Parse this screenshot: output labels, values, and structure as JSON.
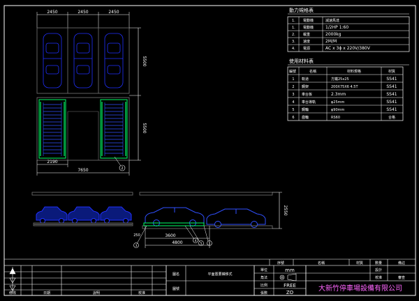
{
  "plan_dims": {
    "top": [
      "2450",
      "2450",
      "2450"
    ],
    "right_upper": "5500",
    "right_lower": "5500",
    "bottom_a": "2190",
    "bottom_b": "7650",
    "bay_label": "2"
  },
  "elevation_dims": {
    "left": "250",
    "middle": "3600",
    "total": "4800",
    "height": "2550",
    "callouts": [
      "3",
      "4",
      "5",
      "1"
    ]
  },
  "power_table": {
    "title": "動力規格表",
    "rows": [
      {
        "no": "1.",
        "item": "電動機",
        "spec": "減速馬達"
      },
      {
        "no": "1.",
        "item": "電動機",
        "spec": "1/2HP 1:60"
      },
      {
        "no": "2.",
        "item": "載重",
        "spec": "2000kg"
      },
      {
        "no": "3.",
        "item": "速度",
        "spec": "2M/M"
      },
      {
        "no": "4.",
        "item": "電源",
        "spec": "AC x 3ϕ x 220V/380V"
      }
    ]
  },
  "material_table": {
    "title": "使用材料表",
    "headers": [
      "編號",
      "名稱",
      "材料規格",
      "材質"
    ],
    "rows": [
      {
        "no": "1",
        "name": "軌道",
        "spec": "方鐵25x25",
        "mat": "SS41"
      },
      {
        "no": "2",
        "name": "鋼架",
        "spec": "200X75X6 4.5T",
        "mat": "SS41"
      },
      {
        "no": "3",
        "name": "車台板",
        "spec": "2.3mm",
        "mat": "SS41"
      },
      {
        "no": "4",
        "name": "車台導軌",
        "spec": "φ25mm",
        "mat": "SS41"
      },
      {
        "no": "5",
        "name": "鋼輪",
        "spec": "φ90mm",
        "mat": "SS41"
      },
      {
        "no": "6",
        "name": "齒輪",
        "spec": "RS60",
        "mat": "合格"
      }
    ]
  },
  "title_block": {
    "revision_label": "修改",
    "date_label": "日期",
    "description_label": "說明",
    "check_label": "校准",
    "drawing_name_label": "圖名",
    "drawing_name": "平面置要橫移式",
    "drawing_no_label": "圖號",
    "unit_label": "單位",
    "unit_value": "mm",
    "projection_label": "角法",
    "scale_label": "比例",
    "scale_value": "FREE",
    "sheet_label": "張數",
    "sheet_value": "ZO",
    "no_col": "序號",
    "name_col": "名稱",
    "material_col": "材質",
    "qty_col": "數量",
    "remark_col": "備註",
    "designer_label": "設計",
    "checker_label": "校准",
    "approver_label": "審查",
    "company": "大新竹停車場設備有限公司"
  },
  "colors": {
    "background": "#000000",
    "frame": "#ffffff",
    "car_outline": "#2030ff",
    "platform": "#00ff66",
    "dimension": "#ffffff",
    "grid_gray": "#777777",
    "table_text": "#ffffff",
    "company": "#ff66ff"
  }
}
